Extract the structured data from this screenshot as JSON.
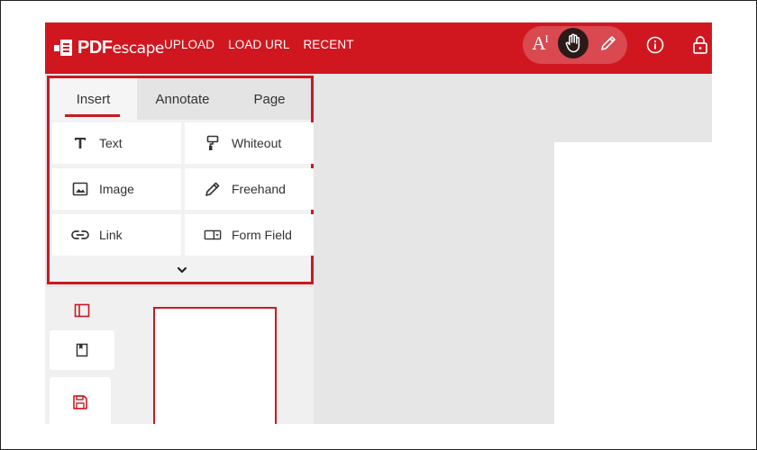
{
  "header": {
    "logo_text_bold": "PDF",
    "logo_text_rest": "escape",
    "nav": [
      "UPLOAD",
      "LOAD URL",
      "RECENT"
    ]
  },
  "toolbar": {
    "text_tool_glyph": "A",
    "text_tool_cursor": "I",
    "icons": [
      "text-tool-icon",
      "hand-icon",
      "pencil-icon",
      "info-icon",
      "lock-icon"
    ]
  },
  "panel": {
    "tabs": [
      "Insert",
      "Annotate",
      "Page"
    ],
    "active_tab": "Insert",
    "buttons": [
      {
        "label": "Text",
        "icon": "text-t-icon"
      },
      {
        "label": "Whiteout",
        "icon": "whiteout-roller-icon"
      },
      {
        "label": "Image",
        "icon": "image-icon"
      },
      {
        "label": "Freehand",
        "icon": "pencil-icon"
      },
      {
        "label": "Link",
        "icon": "link-icon"
      },
      {
        "label": "Form Field",
        "icon": "form-field-icon"
      }
    ]
  },
  "colors": {
    "brand_red": "#d0171f",
    "highlight_red": "#c81a22",
    "workspace_gray": "#e6e6e6"
  }
}
